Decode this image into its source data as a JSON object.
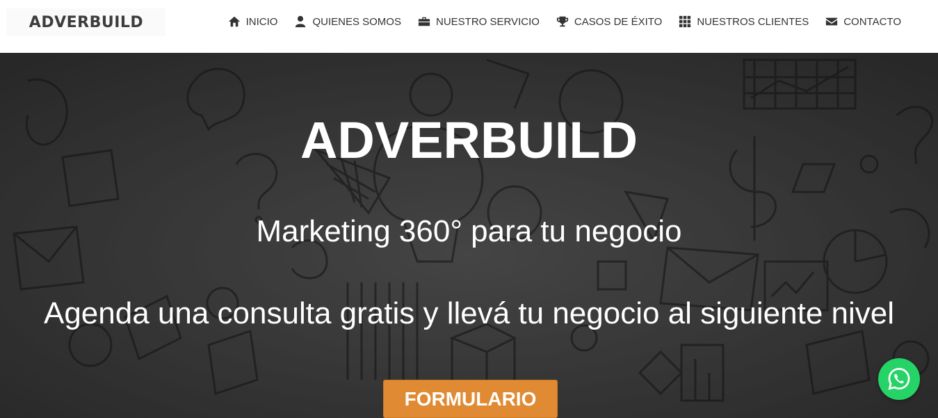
{
  "brand": {
    "logo_text": "ADVERBUILD"
  },
  "nav": {
    "items": [
      {
        "label": "INICIO",
        "icon": "home-icon"
      },
      {
        "label": "QUIENES SOMOS",
        "icon": "user-icon"
      },
      {
        "label": "NUESTRO SERVICIO",
        "icon": "briefcase-icon"
      },
      {
        "label": "CASOS DE ÉXITO",
        "icon": "trophy-icon"
      },
      {
        "label": "NUESTROS CLIENTES",
        "icon": "grid-icon"
      },
      {
        "label": "CONTACTO",
        "icon": "envelope-icon"
      }
    ]
  },
  "hero": {
    "title": "ADVERBUILD",
    "subtitle": "Marketing 360° para tu negocio",
    "tagline": "Agenda una consulta gratis y llevá tu negocio al siguiente nivel",
    "cta_label": "FORMULARIO"
  },
  "colors": {
    "accent": "#e08b33",
    "whatsapp": "#25d366",
    "nav_text": "#333333"
  }
}
